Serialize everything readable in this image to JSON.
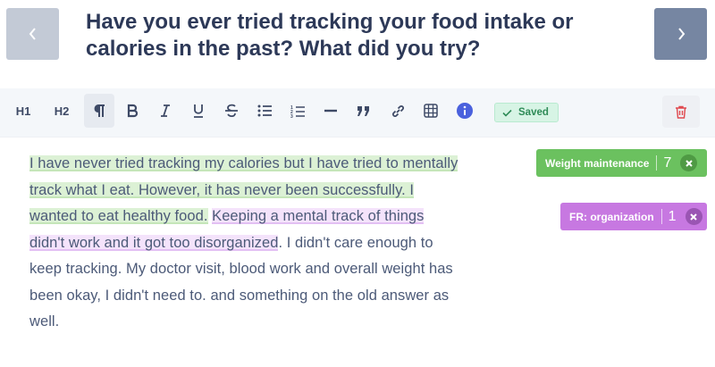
{
  "question": {
    "title": "Have you ever tried tracking your food intake or calories in the past? What did you try?"
  },
  "nav": {
    "prev_icon": "chevron-left-icon",
    "next_icon": "chevron-right-icon"
  },
  "toolbar": {
    "h1_label": "H1",
    "h2_label": "H2",
    "saved_label": "Saved",
    "accent": "#2e8b57"
  },
  "answer": {
    "seg1": "I have never tried tracking my calories but I have tried to mentally track what I eat. However, it has never been successfully. I wanted to eat healthy food.",
    "seg2": "Keeping a mental track of things didn't work and it got too disorganized",
    "seg3": ". I didn't care enough to keep tracking. My doctor visit, blood work and overall weight has been okay, I didn't need to. and something on the old answer as well."
  },
  "tags": [
    {
      "label": "Weight maintenance",
      "count": "7",
      "color": "#6bc15f"
    },
    {
      "label": "FR: organization",
      "count": "1",
      "color": "#c778e1"
    }
  ]
}
